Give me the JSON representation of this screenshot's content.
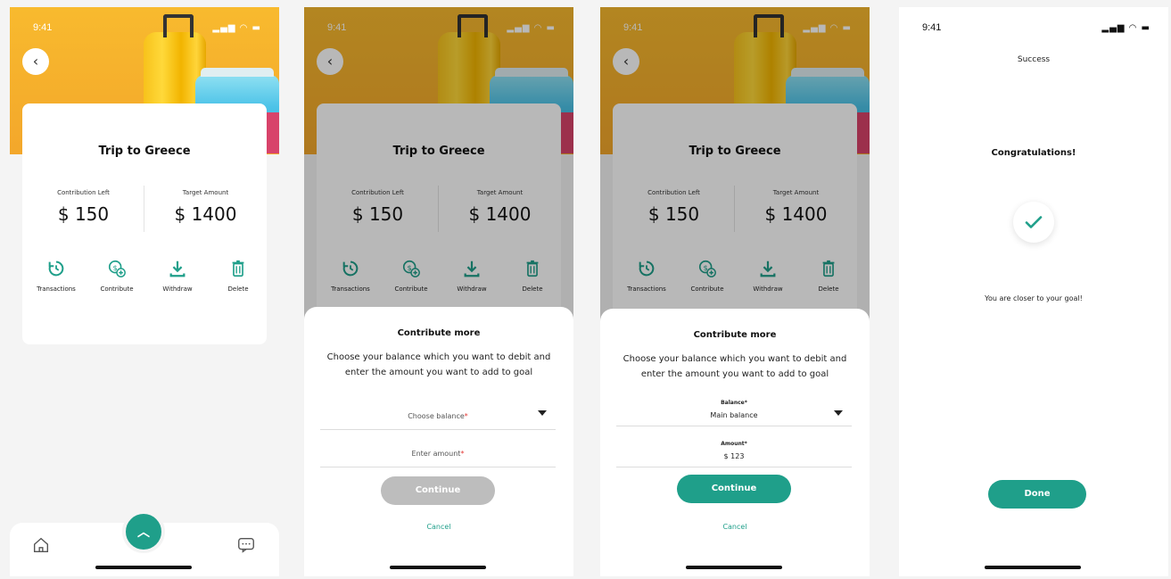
{
  "status": {
    "time": "9:41",
    "indicators": "signal wifi battery"
  },
  "goal": {
    "title": "Trip to Greece",
    "contribution_left_label": "Contribution Left",
    "contribution_left_value": "$ 150",
    "target_amount_label": "Target Amount",
    "target_amount_value": "$ 1400"
  },
  "actions": {
    "transactions": "Transactions",
    "contribute": "Contribute",
    "withdraw": "Withdraw",
    "delete": "Delete"
  },
  "sheet": {
    "title": "Contribute more",
    "description": "Choose your balance which you want to debit and enter the amount you want to add to goal",
    "balance_placeholder": "Choose balance",
    "amount_placeholder": "Enter amount",
    "required_mark": "*",
    "balance_label": "Balance",
    "balance_value": "Main balance",
    "amount_label": "Amount",
    "amount_value": "$ 123",
    "continue": "Continue",
    "cancel": "Cancel"
  },
  "success": {
    "header": "Success",
    "title": "Congratulations!",
    "message": "You are closer to your goal!",
    "done": "Done"
  },
  "colors": {
    "accent": "#1f9f8a",
    "hero": "#f6b131",
    "disabled": "#bdbdbd",
    "required": "#e53935"
  },
  "icons": [
    "back-arrow-icon",
    "transactions-icon",
    "contribute-icon",
    "withdraw-icon",
    "delete-icon",
    "home-icon",
    "chevron-up-icon",
    "chat-icon",
    "check-icon"
  ]
}
